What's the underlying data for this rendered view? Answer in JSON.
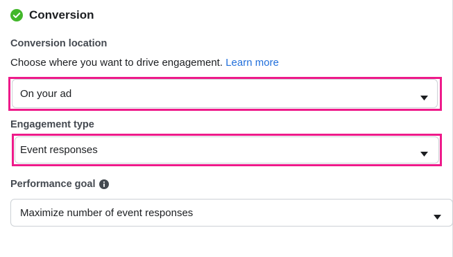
{
  "section": {
    "title": "Conversion",
    "status_icon": "check-circle-icon",
    "status_color": "#42b72a"
  },
  "conversion_location": {
    "label": "Conversion location",
    "description": "Choose where you want to drive engagement.",
    "learn_more": "Learn more",
    "selected": "On your ad"
  },
  "engagement_type": {
    "label": "Engagement type",
    "selected": "Event responses"
  },
  "performance_goal": {
    "label": "Performance goal",
    "info_icon": "info-icon",
    "selected": "Maximize number of event responses"
  },
  "colors": {
    "highlight": "#ee1a8a",
    "link": "#216fdb"
  }
}
